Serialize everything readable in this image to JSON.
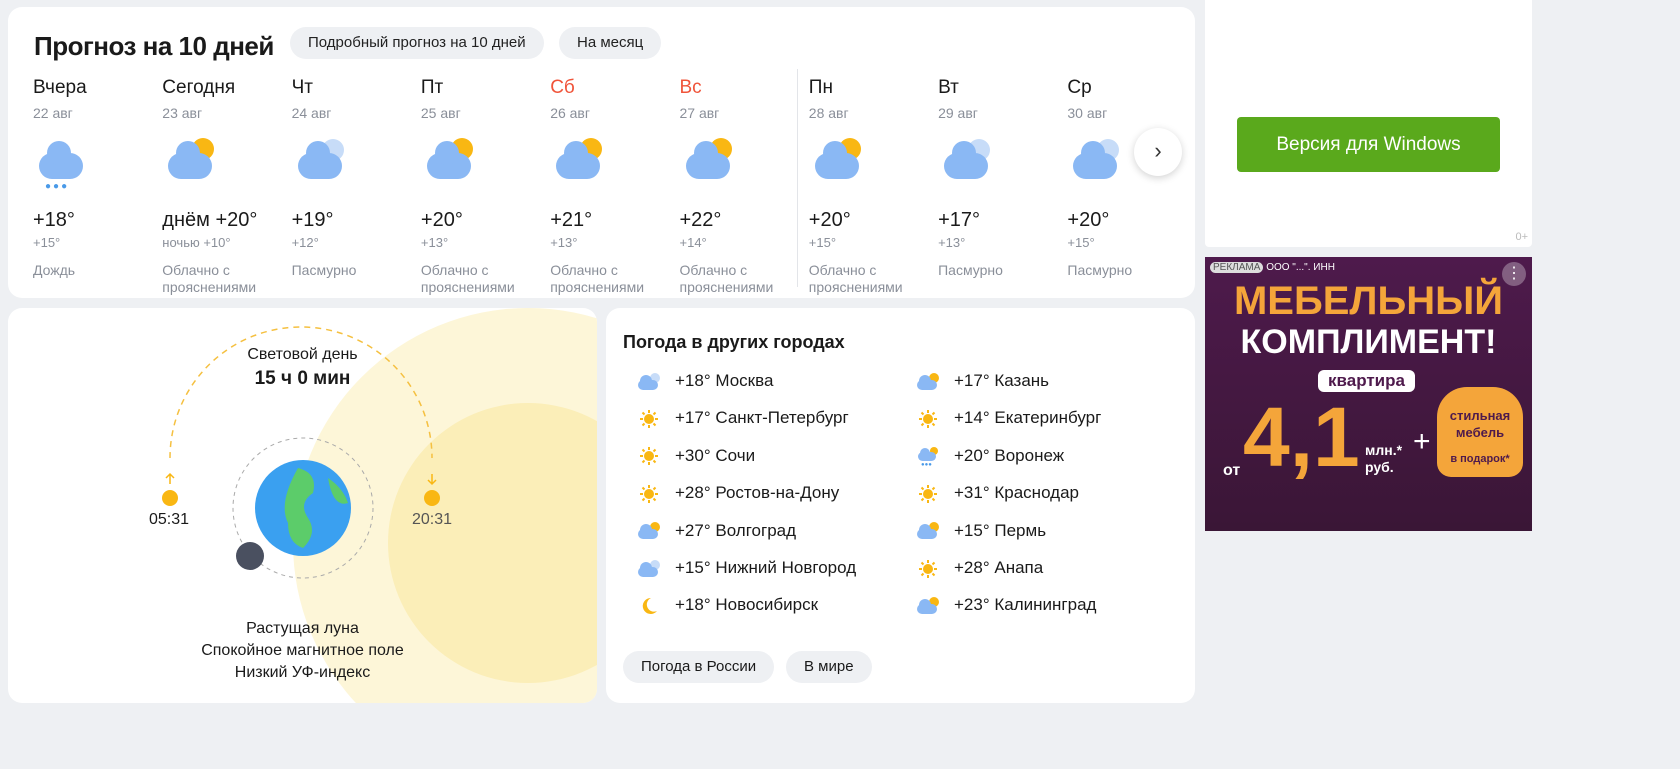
{
  "forecast": {
    "title": "Прогноз на 10 дней",
    "detail_btn": "Подробный прогноз на 10 дней",
    "month_btn": "На месяц",
    "days": [
      {
        "name": "Вчера",
        "date": "22 авг",
        "temp": "+18°",
        "night": "+15°",
        "cond": "Дождь",
        "icon": "rain"
      },
      {
        "name": "Сегодня",
        "date": "23 авг",
        "temp": "днём +20°",
        "night": "ночью +10°",
        "cond": "Облачно с прояснениями",
        "icon": "partly-cloudy"
      },
      {
        "name": "Чт",
        "date": "24 авг",
        "temp": "+19°",
        "night": "+12°",
        "cond": "Пасмурно",
        "icon": "overcast"
      },
      {
        "name": "Пт",
        "date": "25 авг",
        "temp": "+20°",
        "night": "+13°",
        "cond": "Облачно с прояснениями",
        "icon": "partly-cloudy"
      },
      {
        "name": "Сб",
        "date": "26 авг",
        "temp": "+21°",
        "night": "+13°",
        "cond": "Облачно с прояснениями",
        "icon": "partly-cloudy",
        "weekend": true
      },
      {
        "name": "Вс",
        "date": "27 авг",
        "temp": "+22°",
        "night": "+14°",
        "cond": "Облачно с прояснениями",
        "icon": "partly-cloudy",
        "weekend": true
      },
      {
        "name": "Пн",
        "date": "28 авг",
        "temp": "+20°",
        "night": "+15°",
        "cond": "Облачно с прояснениями",
        "icon": "partly-cloudy"
      },
      {
        "name": "Вт",
        "date": "29 авг",
        "temp": "+17°",
        "night": "+13°",
        "cond": "Пасмурно",
        "icon": "overcast"
      },
      {
        "name": "Ср",
        "date": "30 авг",
        "temp": "+20°",
        "night": "+15°",
        "cond": "Пасмурно",
        "icon": "overcast"
      }
    ]
  },
  "daylight": {
    "label": "Световой день",
    "duration": "15 ч 0 мин",
    "sunrise": "05:31",
    "sunset": "20:31",
    "moon": "Растущая луна",
    "magnetic": "Спокойное магнитное поле",
    "uv": "Низкий УФ-индекс"
  },
  "cities": {
    "title": "Погода в других городах",
    "russia_btn": "Погода в России",
    "world_btn": "В мире",
    "left": [
      {
        "temp": "+18°",
        "name": "Москва",
        "icon": "overcast"
      },
      {
        "temp": "+17°",
        "name": "Санкт-Петербург",
        "icon": "sun"
      },
      {
        "temp": "+30°",
        "name": "Сочи",
        "icon": "sun"
      },
      {
        "temp": "+28°",
        "name": "Ростов-на-Дону",
        "icon": "sun"
      },
      {
        "temp": "+27°",
        "name": "Волгоград",
        "icon": "partly-cloudy"
      },
      {
        "temp": "+15°",
        "name": "Нижний Новгород",
        "icon": "overcast"
      },
      {
        "temp": "+18°",
        "name": "Новосибирск",
        "icon": "moon"
      }
    ],
    "right": [
      {
        "temp": "+17°",
        "name": "Казань",
        "icon": "partly-cloudy"
      },
      {
        "temp": "+14°",
        "name": "Екатеринбург",
        "icon": "sun"
      },
      {
        "temp": "+20°",
        "name": "Воронеж",
        "icon": "rain"
      },
      {
        "temp": "+31°",
        "name": "Краснодар",
        "icon": "sun"
      },
      {
        "temp": "+15°",
        "name": "Пермь",
        "icon": "partly-cloudy"
      },
      {
        "temp": "+28°",
        "name": "Анапа",
        "icon": "sun"
      },
      {
        "temp": "+23°",
        "name": "Калининград",
        "icon": "partly-cloudy"
      }
    ]
  },
  "promo": {
    "button": "Версия для Windows",
    "age": "0+"
  },
  "ad": {
    "label": "РЕКЛАМА",
    "advertiser": "ООО \"...\". ИНН",
    "headline1": "МЕБЕЛЬНЫЙ",
    "headline2": "КОМПЛИМЕНТ!",
    "tag": "квартира",
    "prefix": "от",
    "price": "4,1",
    "unit1": "млн.*",
    "unit2": "руб.",
    "plus": "+",
    "gift1": "стильная",
    "gift2": "мебель",
    "gift3": "в подарок*"
  }
}
